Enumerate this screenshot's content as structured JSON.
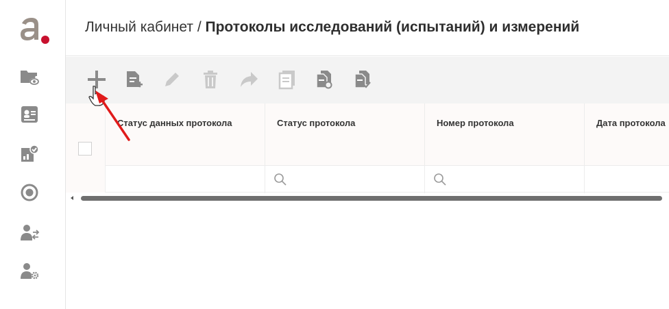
{
  "header": {
    "breadcrumb": "Личный кабинет /",
    "page_title": "Протоколы исследований (испытаний) и измерений"
  },
  "sidebar": {
    "logo_letter": "a",
    "items": [
      {
        "icon": "folder-eye-icon"
      },
      {
        "icon": "id-card-icon"
      },
      {
        "icon": "report-check-icon"
      },
      {
        "icon": "radio-circle-icon"
      },
      {
        "icon": "users-transfer-icon"
      },
      {
        "icon": "user-settings-icon"
      }
    ]
  },
  "toolbar": {
    "buttons": [
      {
        "icon": "add-icon",
        "enabled": true
      },
      {
        "icon": "add-document-icon",
        "enabled": true
      },
      {
        "icon": "edit-icon",
        "enabled": false
      },
      {
        "icon": "delete-icon",
        "enabled": false
      },
      {
        "icon": "share-icon",
        "enabled": false
      },
      {
        "icon": "list-icon",
        "enabled": false
      },
      {
        "icon": "copy-documents-icon",
        "enabled": true
      },
      {
        "icon": "approve-documents-icon",
        "enabled": true
      }
    ]
  },
  "table": {
    "columns": [
      {
        "title": "Статус данных протокола"
      },
      {
        "title": "Статус протокола"
      },
      {
        "title": "Номер протокола"
      },
      {
        "title": "Дата протокола"
      }
    ]
  },
  "colors": {
    "brand_red": "#c8102e",
    "logo_gray": "#9a9088",
    "icon_gray": "#8a8a8a",
    "icon_disabled": "#c9c9c9",
    "annotation_arrow": "#e01b1b"
  }
}
